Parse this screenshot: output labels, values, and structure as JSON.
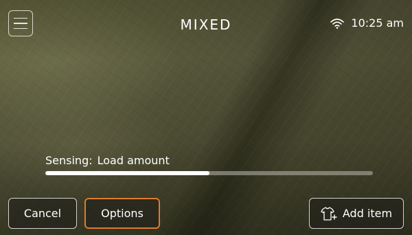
{
  "header": {
    "title": "MIXED",
    "time": "10:25 am",
    "menu_icon": "hamburger-menu-icon",
    "wifi_icon": "wifi-icon"
  },
  "status": {
    "sensing_label": "Sensing:",
    "sensing_value": "Load amount",
    "progress_fraction": 0.5
  },
  "actions": {
    "cancel_label": "Cancel",
    "options_label": "Options",
    "add_item_label": "Add item",
    "add_item_icon": "shirt-add-icon"
  },
  "colors": {
    "accent_orange": "#e07a2e",
    "progress_fill": "#ffffff",
    "progress_track": "#b9b9af"
  }
}
